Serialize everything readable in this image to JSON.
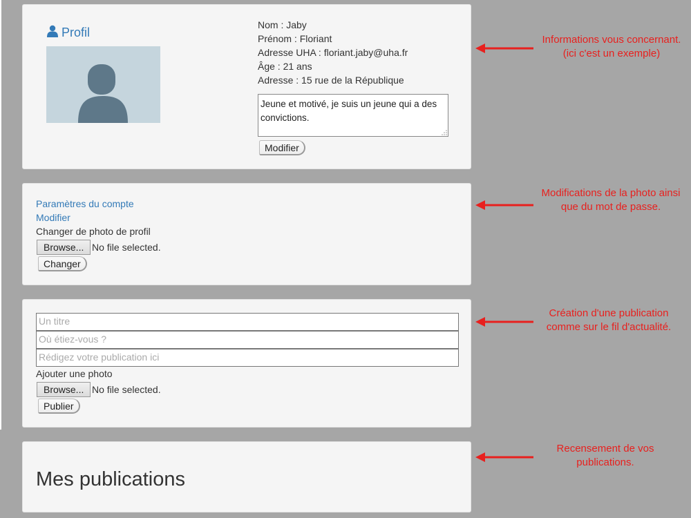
{
  "profile": {
    "title": "Profil",
    "icon": "user-icon",
    "fields": [
      "Nom : Jaby",
      "Prénom : Floriant",
      "Adresse UHA : floriant.jaby@uha.fr",
      "Âge : 21 ans",
      "Adresse : 15 rue de la République"
    ],
    "bio": "Jeune et motivé, je suis un jeune qui a des convictions.",
    "edit_button": "Modifier"
  },
  "settings": {
    "heading_link": "Paramètres du compte",
    "edit_link": "Modifier",
    "photo_label": "Changer de photo de profil",
    "browse_button": "Browse...",
    "file_status": "No file selected.",
    "change_button": "Changer"
  },
  "publish": {
    "title_placeholder": "Un titre",
    "location_placeholder": "Où étiez-vous ?",
    "body_placeholder": "Rédigez votre publication ici",
    "photo_label": "Ajouter une photo",
    "browse_button": "Browse...",
    "file_status": "No file selected.",
    "submit_button": "Publier"
  },
  "my_publications": {
    "title": "Mes publications"
  },
  "annotations": {
    "profile_note": [
      "Informations vous concernant.",
      "(ici c'est un exemple)"
    ],
    "settings_note": [
      "Modifications de la photo ainsi",
      "que du mot de passe."
    ],
    "publish_note": [
      "Création d'une publication",
      "comme sur le fil d'actualité."
    ],
    "mypubs_note": [
      "Recensement de vos",
      "publications."
    ]
  },
  "colors": {
    "background": "#a6a6a6",
    "card": "#f5f5f5",
    "link": "#337ab7",
    "annotation": "#e8201e",
    "avatar_bg": "#c5d5dd",
    "avatar_fg": "#5e7889"
  }
}
